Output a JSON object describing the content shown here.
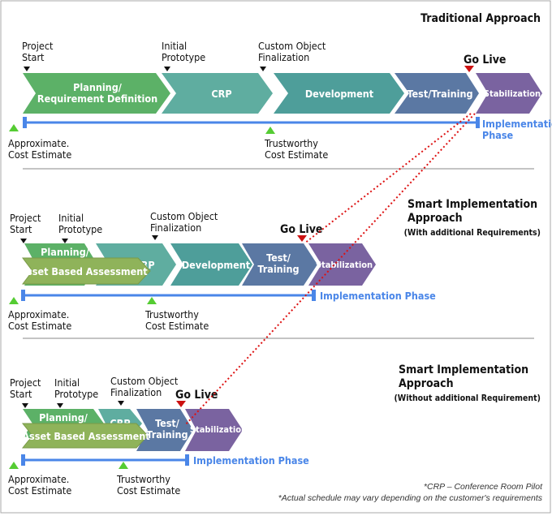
{
  "colors": {
    "planning": "#5cb167",
    "crp": "#5fada0",
    "development": "#4e9e9a",
    "test": "#5b78a3",
    "stabilization": "#7a63a0",
    "asset": "#8fb35a",
    "timeline": "#4a86e8",
    "go_live_marker": "#cc1111",
    "estimate_marker": "#55cc33"
  },
  "traditional": {
    "title": "Traditional Approach",
    "milestones": {
      "project_start": [
        "Project",
        "Start"
      ],
      "initial_prototype": [
        "Initial",
        "Prototype"
      ],
      "custom_object": [
        "Custom Object",
        "Finalization"
      ],
      "go_live": "Go Live"
    },
    "phases": {
      "planning": [
        "Planning/",
        "Requirement Definition"
      ],
      "crp": "CRP",
      "development": "Development",
      "test": "Test/Training",
      "stabilization": "Stabilization"
    },
    "implementation": [
      "Implementation",
      "Phase"
    ],
    "estimates": {
      "approx": [
        "Approximate.",
        "Cost Estimate"
      ],
      "trust": [
        "Trustworthy",
        "Cost Estimate"
      ]
    }
  },
  "smart_with": {
    "title": [
      "Smart Implementation",
      "Approach"
    ],
    "subtitle": "(With additional Requirements)",
    "milestones": {
      "project_start": [
        "Project",
        "Start"
      ],
      "initial_prototype": [
        "Initial",
        "Prototype"
      ],
      "custom_object": [
        "Custom Object",
        "Finalization"
      ],
      "go_live": "Go Live"
    },
    "phases": {
      "planning": "Planning/",
      "crp": "CRP",
      "asset": "Asset Based Assessment",
      "development": "Development",
      "test": [
        "Test/",
        "Training"
      ],
      "stabilization": "Stabilization"
    },
    "implementation": "Implementation Phase",
    "estimates": {
      "approx": [
        "Approximate.",
        "Cost Estimate"
      ],
      "trust": [
        "Trustworthy",
        "Cost Estimate"
      ]
    }
  },
  "smart_without": {
    "title": [
      "Smart Implementation",
      "Approach"
    ],
    "subtitle": "(Without additional Requirement)",
    "milestones": {
      "project_start": [
        "Project",
        "Start"
      ],
      "initial_prototype": [
        "Initial",
        "Prototype"
      ],
      "custom_object": [
        "Custom Object",
        "Finalization"
      ],
      "go_live": "Go Live"
    },
    "phases": {
      "planning": "Planning/",
      "crp": "CRP",
      "asset": "Asset Based Assessment",
      "test": [
        "Test/",
        "Training"
      ],
      "stabilization": "Stabilization"
    },
    "implementation": "Implementation Phase",
    "estimates": {
      "approx": [
        "Approximate.",
        "Cost Estimate"
      ],
      "trust": [
        "Trustworthy",
        "Cost Estimate"
      ]
    }
  },
  "notes": [
    "*CRP – Conference Room Pilot",
    "*Actual schedule may vary depending on the customer's requirements"
  ]
}
